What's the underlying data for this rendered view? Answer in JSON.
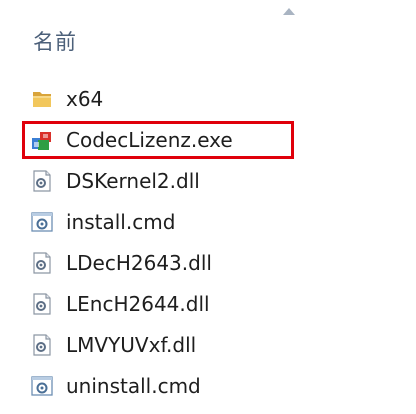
{
  "header": {
    "name_column": "名前"
  },
  "files": [
    {
      "name": "x64",
      "icon": "folder-icon"
    },
    {
      "name": "CodecLizenz.exe",
      "icon": "exe-app-icon"
    },
    {
      "name": "DSKernel2.dll",
      "icon": "dll-gear-icon"
    },
    {
      "name": "install.cmd",
      "icon": "cmd-gear-icon"
    },
    {
      "name": "LDecH2643.dll",
      "icon": "dll-gear-icon"
    },
    {
      "name": "LEncH2644.dll",
      "icon": "dll-gear-icon"
    },
    {
      "name": "LMVYUVxf.dll",
      "icon": "dll-gear-icon"
    },
    {
      "name": "uninstall.cmd",
      "icon": "cmd-gear-icon"
    }
  ],
  "colors": {
    "highlight": "#e0000b",
    "header_text": "#4c607a",
    "folder": "#e8b84a"
  }
}
